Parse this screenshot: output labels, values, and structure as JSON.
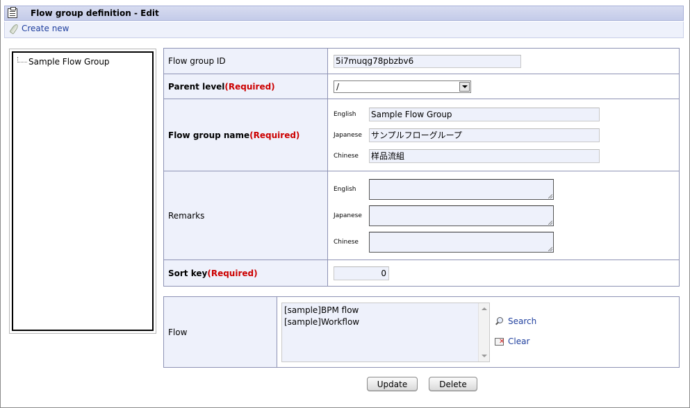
{
  "header": {
    "title": "Flow group definition - Edit",
    "icon": "clipboard-icon"
  },
  "toolbar": {
    "create_new_label": "Create new",
    "create_new_icon": "feather-icon"
  },
  "tree": {
    "items": [
      {
        "label": "Sample Flow Group"
      }
    ]
  },
  "form": {
    "flow_group_id": {
      "label": "Flow group ID",
      "value": "5i7muqg78pbzbv6"
    },
    "parent_level": {
      "label": "Parent level",
      "required": "(Required)",
      "value": "/"
    },
    "flow_group_name": {
      "label": "Flow group name",
      "required": "(Required)",
      "english_label": "English",
      "english_value": "Sample Flow Group",
      "japanese_label": "Japanese",
      "japanese_value": "サンプルフローグループ",
      "chinese_label": "Chinese",
      "chinese_value": "样品流組"
    },
    "remarks": {
      "label": "Remarks",
      "english_label": "English",
      "english_value": "",
      "japanese_label": "Japanese",
      "japanese_value": "",
      "chinese_label": "Chinese",
      "chinese_value": ""
    },
    "sort_key": {
      "label": "Sort key",
      "required": "(Required)",
      "value": "0"
    }
  },
  "flow": {
    "label": "Flow",
    "items": [
      "[sample]BPM flow",
      "[sample]Workflow"
    ],
    "search_label": "Search",
    "clear_label": "Clear"
  },
  "actions": {
    "update_label": "Update",
    "delete_label": "Delete"
  },
  "colors": {
    "header_bg": "#c4cbe9",
    "label_bg": "#eef1fb",
    "required": "#cc0000",
    "link": "#1f3f9e",
    "border": "#8d92b4"
  }
}
